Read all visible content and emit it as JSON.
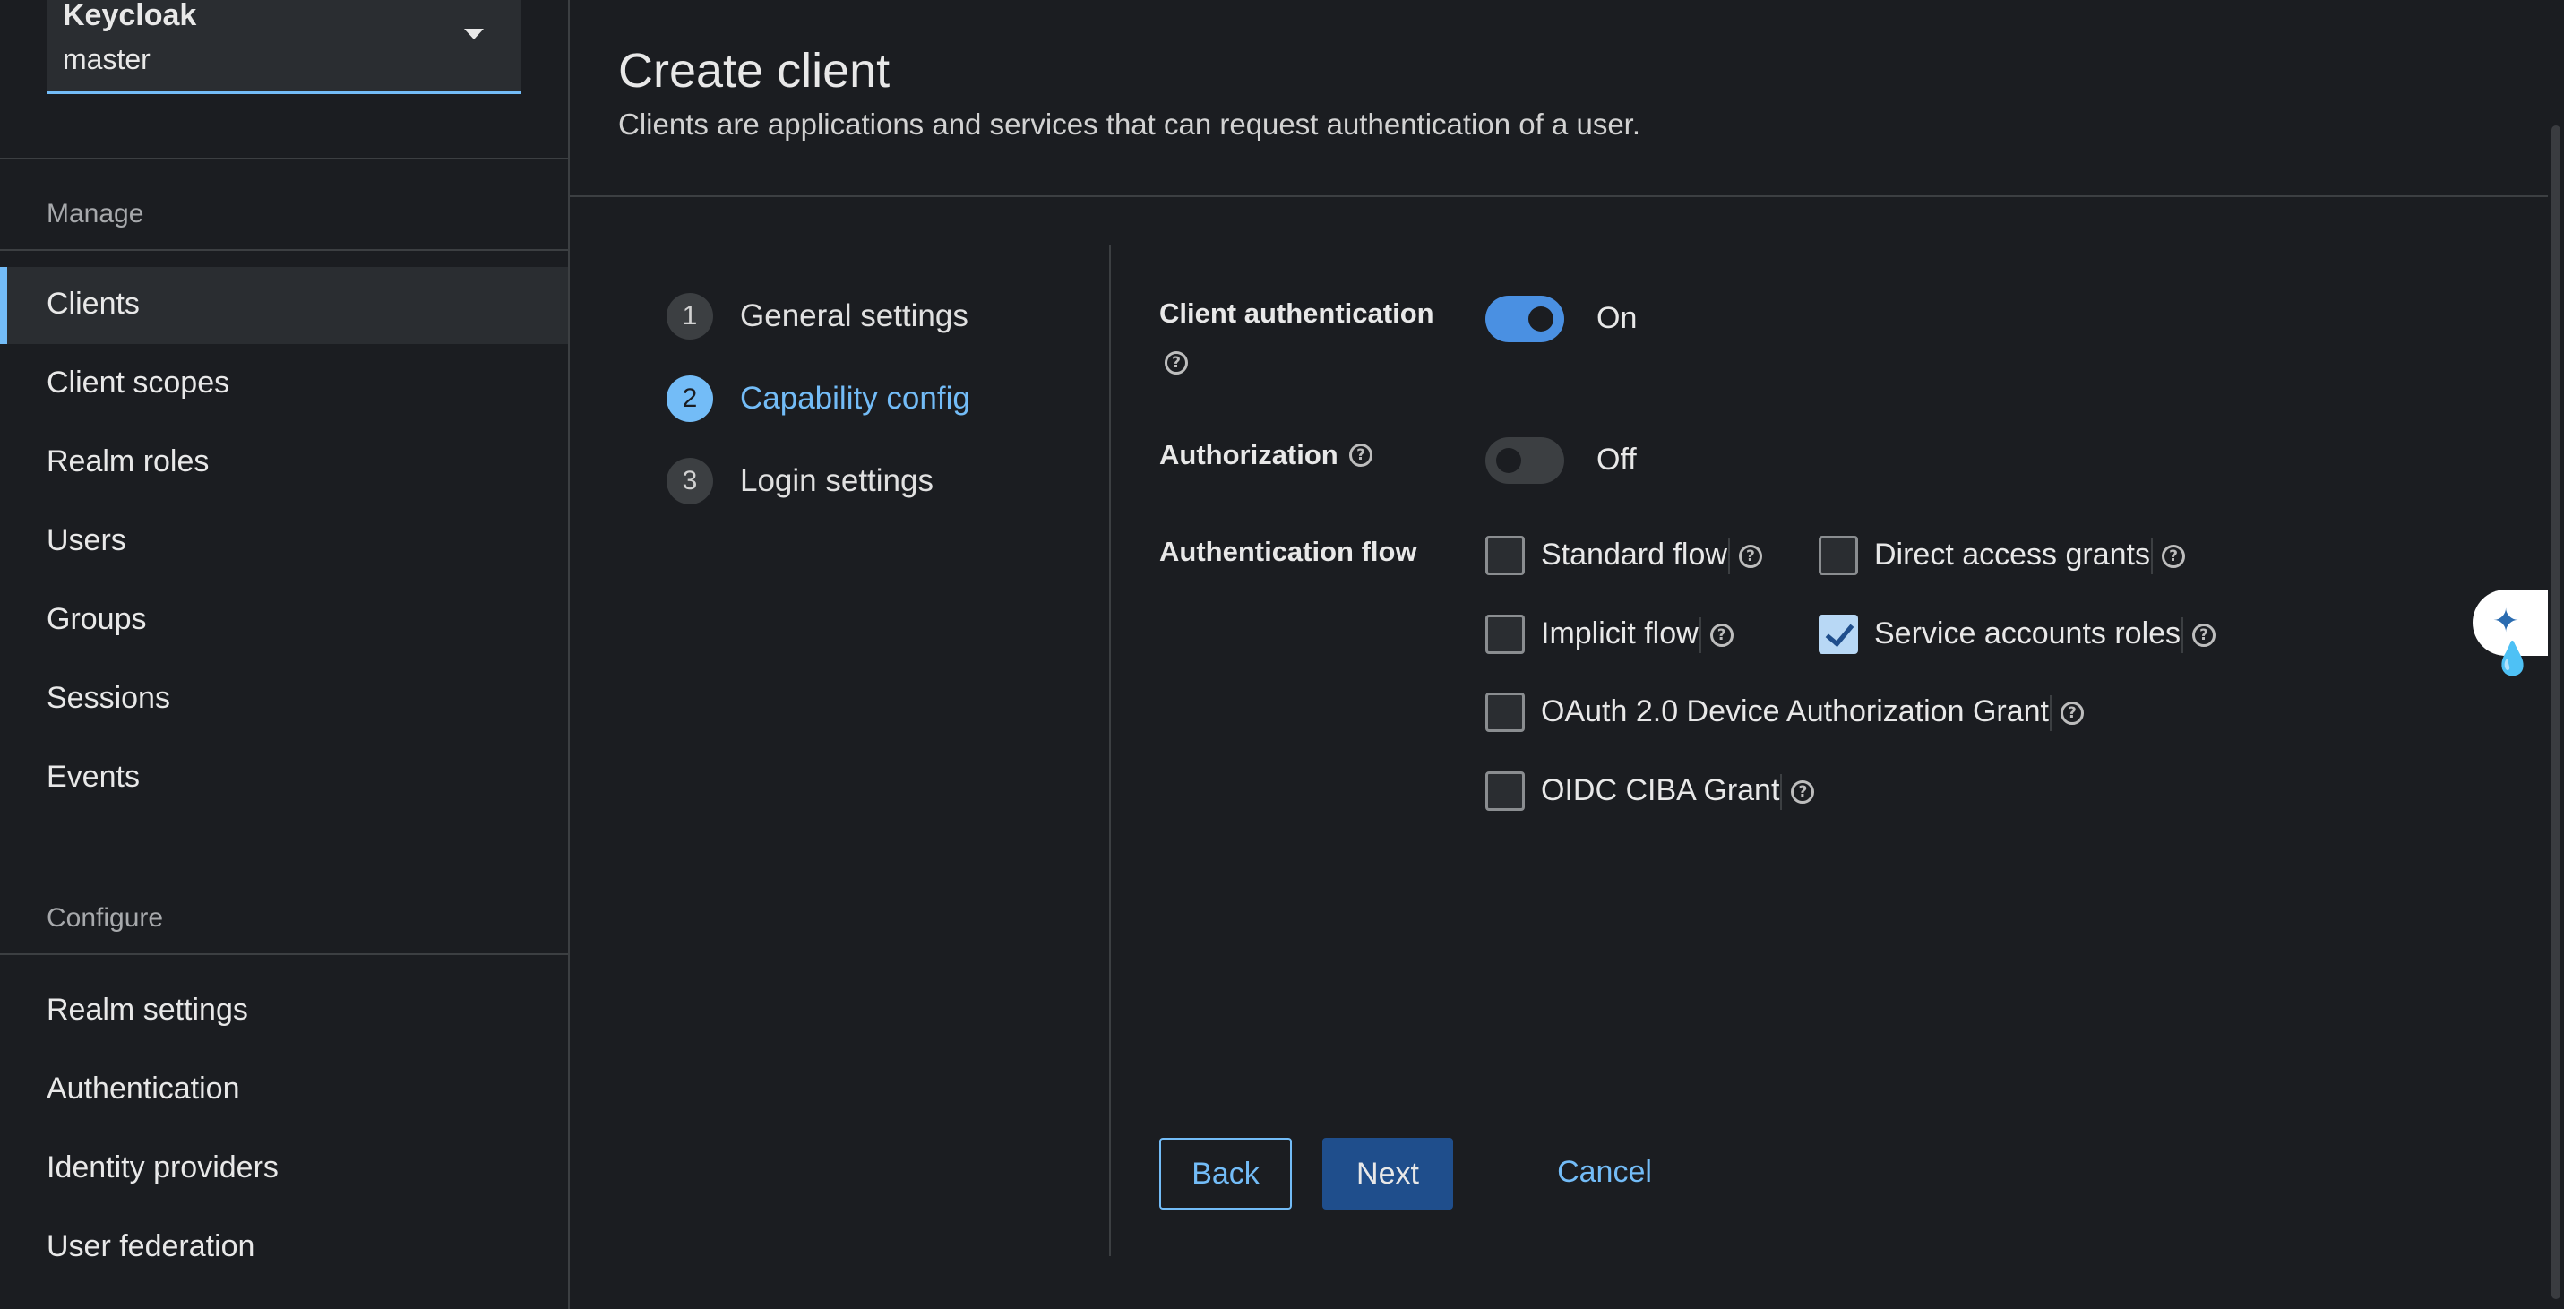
{
  "realm": {
    "name": "Keycloak",
    "value": "master"
  },
  "sidebar": {
    "manage_label": "Manage",
    "manage_items": [
      {
        "label": "Clients",
        "active": true
      },
      {
        "label": "Client scopes"
      },
      {
        "label": "Realm roles"
      },
      {
        "label": "Users"
      },
      {
        "label": "Groups"
      },
      {
        "label": "Sessions"
      },
      {
        "label": "Events"
      }
    ],
    "configure_label": "Configure",
    "configure_items": [
      {
        "label": "Realm settings"
      },
      {
        "label": "Authentication"
      },
      {
        "label": "Identity providers"
      },
      {
        "label": "User federation"
      }
    ]
  },
  "header": {
    "title": "Create client",
    "description": "Clients are applications and services that can request authentication of a user."
  },
  "wizard": {
    "steps": [
      {
        "num": "1",
        "label": "General settings"
      },
      {
        "num": "2",
        "label": "Capability config",
        "current": true
      },
      {
        "num": "3",
        "label": "Login settings"
      }
    ]
  },
  "form": {
    "client_auth": {
      "label": "Client authentication",
      "state": "On",
      "enabled": true
    },
    "authorization": {
      "label": "Authorization",
      "state": "Off",
      "enabled": false
    },
    "auth_flow": {
      "label": "Authentication flow",
      "options": [
        {
          "label": "Standard flow",
          "checked": false
        },
        {
          "label": "Direct access grants",
          "checked": false
        },
        {
          "label": "Implicit flow",
          "checked": false
        },
        {
          "label": "Service accounts roles",
          "checked": true
        },
        {
          "label": "OAuth 2.0 Device Authorization Grant",
          "checked": false
        },
        {
          "label": "OIDC CIBA Grant",
          "checked": false
        }
      ]
    }
  },
  "actions": {
    "back": "Back",
    "next": "Next",
    "cancel": "Cancel"
  },
  "icons": {
    "help": "?",
    "ai_assistant": "sparkle-drop-icon"
  },
  "colors": {
    "accent": "#73bcf7",
    "primary_button": "#1f4e8c",
    "background": "#1b1d21"
  }
}
